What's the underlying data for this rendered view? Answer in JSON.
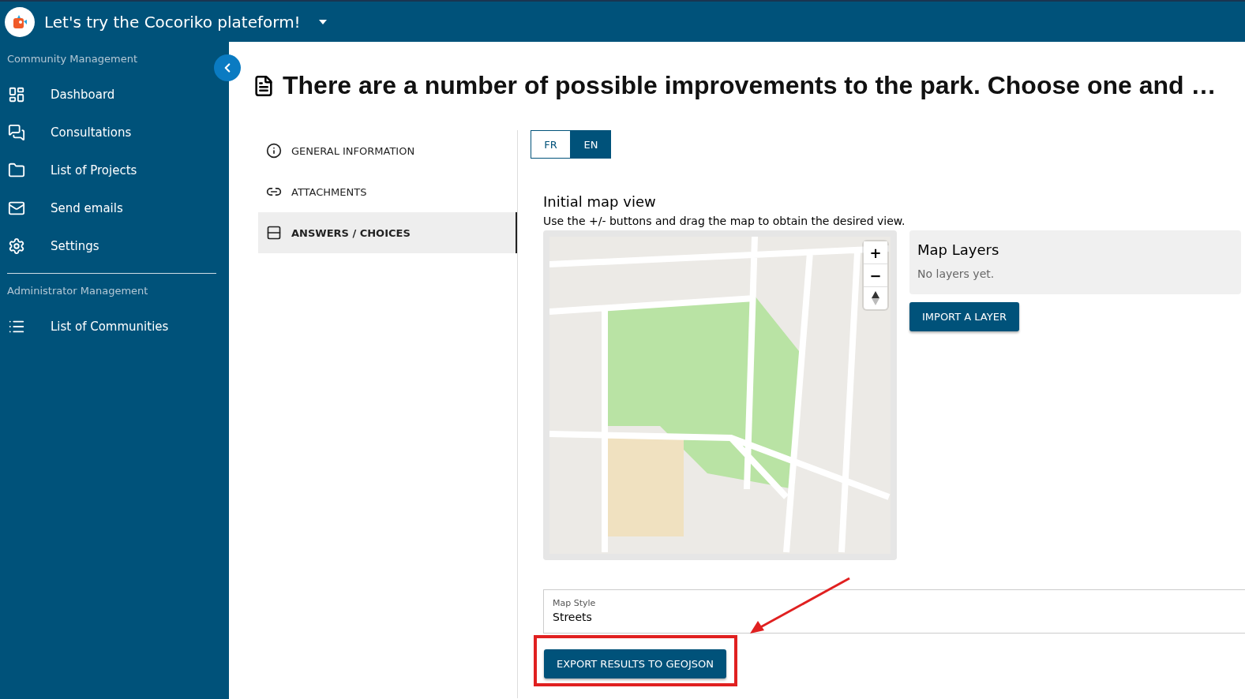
{
  "header": {
    "title": "Let's try the Cocoriko plateform!"
  },
  "sidebar": {
    "sections": [
      {
        "heading": "Community Management",
        "items": [
          {
            "label": "Dashboard"
          },
          {
            "label": "Consultations"
          },
          {
            "label": "List of Projects"
          },
          {
            "label": "Send emails"
          },
          {
            "label": "Settings"
          }
        ]
      },
      {
        "heading": "Administrator Management",
        "items": [
          {
            "label": "List of Communities"
          }
        ]
      }
    ]
  },
  "page": {
    "title": "There are a number of possible improvements to the park. Choose one and …"
  },
  "tabs": [
    {
      "label": "GENERAL INFORMATION",
      "selected": false
    },
    {
      "label": "ATTACHMENTS",
      "selected": false
    },
    {
      "label": "ANSWERS / CHOICES",
      "selected": true
    }
  ],
  "languages": [
    {
      "label": "FR",
      "selected": false
    },
    {
      "label": "EN",
      "selected": true
    }
  ],
  "map": {
    "title": "Initial map view",
    "hint": "Use the +/- buttons and drag the map to obtain the desired view.",
    "zoom_in": "+",
    "zoom_out": "−"
  },
  "layers": {
    "title": "Map Layers",
    "empty": "No layers yet.",
    "button": "IMPORT A LAYER"
  },
  "map_style": {
    "label": "Map Style",
    "value": "Streets"
  },
  "export_button": "EXPORT RESULTS TO GEOJSON"
}
